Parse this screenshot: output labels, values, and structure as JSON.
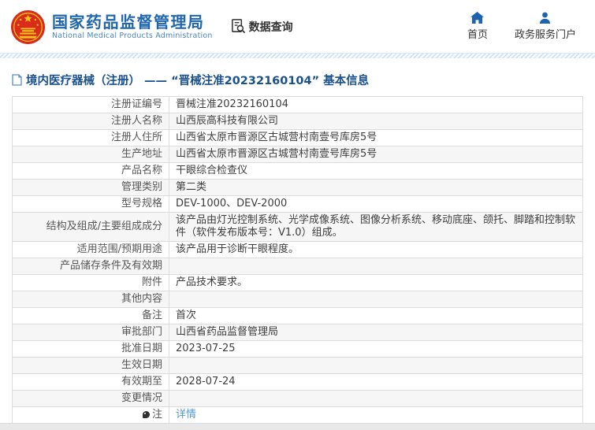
{
  "header": {
    "brand_title": "国家药品监督管理局",
    "brand_subtitle": "National Medical Products Administration",
    "data_query_label": "数据查询",
    "nav": [
      {
        "label": "首页",
        "icon": "home-icon"
      },
      {
        "label": "政务服务门户",
        "icon": "user-icon"
      }
    ]
  },
  "breadcrumb": {
    "text": "境内医疗器械（注册） —— “晋械注准20232160104” 基本信息"
  },
  "table": {
    "rows": [
      {
        "label": "注册证编号",
        "value": "晋械注准20232160104"
      },
      {
        "label": "注册人名称",
        "value": "山西辰高科技有限公司"
      },
      {
        "label": "注册人住所",
        "value": "山西省太原市晋源区古城营村南壹号库房5号"
      },
      {
        "label": "生产地址",
        "value": "山西省太原市晋源区古城营村南壹号库房5号"
      },
      {
        "label": "产品名称",
        "value": "干眼综合检查仪"
      },
      {
        "label": "管理类别",
        "value": "第二类"
      },
      {
        "label": "型号规格",
        "value": "DEV-1000、DEV-2000"
      },
      {
        "label": "结构及组成/主要组成成分",
        "value": "该产品由灯光控制系统、光学成像系统、图像分析系统、移动底座、颌托、脚踏和控制软件（软件发布版本号：V1.0）组成。"
      },
      {
        "label": "适用范围/预期用途",
        "value": "该产品用于诊断干眼程度。"
      },
      {
        "label": "产品储存条件及有效期",
        "value": ""
      },
      {
        "label": "附件",
        "value": "产品技术要求。"
      },
      {
        "label": "其他内容",
        "value": ""
      },
      {
        "label": "备注",
        "value": "首次"
      },
      {
        "label": "审批部门",
        "value": "山西省药品监督管理局"
      },
      {
        "label": "批准日期",
        "value": "2023-07-25"
      },
      {
        "label": "生效日期",
        "value": ""
      },
      {
        "label": "有效期至",
        "value": "2028-07-24"
      },
      {
        "label": "变更情况",
        "value": ""
      },
      {
        "label": "注",
        "label_icon": "note-icon",
        "value": "详情",
        "value_is_link": true
      }
    ]
  },
  "colors": {
    "brand_blue": "#2066ad",
    "breadcrumb_blue": "#19508e",
    "link_blue": "#4e9ad2",
    "nav_icon_blue": "#1e63b0",
    "emblem_red": "#d92b1c",
    "emblem_gold": "#f2c11e",
    "row_stripe": "#f6f6f6",
    "table_border": "#dcdcdc"
  }
}
